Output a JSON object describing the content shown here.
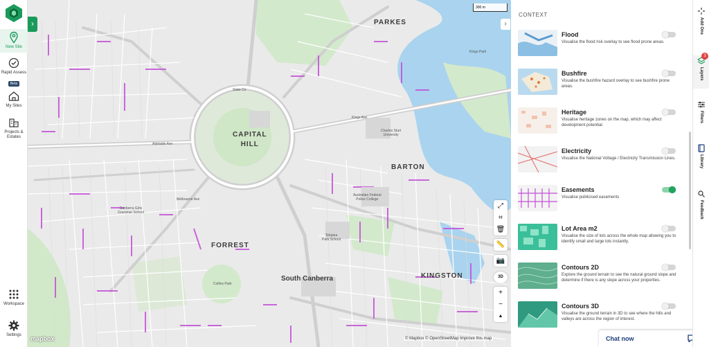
{
  "nav": {
    "items": [
      {
        "label": "New Site",
        "icon": "map-pin-icon"
      },
      {
        "label": "Rapid Assess",
        "badge": "Beta",
        "icon": "check-circle-icon"
      },
      {
        "label": "My Sites",
        "icon": "house-icon"
      },
      {
        "label": "Projects & Estates",
        "icon": "buildings-icon"
      },
      {
        "label": "Workspace",
        "icon": "grid-icon"
      },
      {
        "label": "Settings",
        "icon": "gear-icon"
      }
    ]
  },
  "map": {
    "scale_label": "300 m",
    "labels": {
      "capital_hill": "CAPITAL\nHILL",
      "parkes": "PARKES",
      "barton": "BARTON",
      "forrest": "FORREST",
      "south_canberra": "South Canberra",
      "kingston": "KINGSTON",
      "state_cir": "State Cir",
      "kings_ave": "Kings Ave",
      "adelaide_ave": "Adelaide Ave",
      "melbourne_ave": "Melbourne Ave",
      "canberra_girls": "Canberra Girls\nGrammar School",
      "telopea": "Telopea\nPark School",
      "charles_sturt": "Charles Sturt\nUniversity",
      "afp_college": "Australian Federal\nPolice College",
      "kings_park": "Kings Park",
      "collins_park": "Collins Park"
    },
    "attribution": "© Mapbox © OpenStreetMap Improve this map",
    "mapbox_logo": "mapbox"
  },
  "panel": {
    "title": "CONTEXT",
    "layers": [
      {
        "name": "Flood",
        "desc": "Visualise the flood risk overlay to see flood prone areas.",
        "enabled": false
      },
      {
        "name": "Bushfire",
        "desc": "Visualise the bushfire hazard overlay to see bushfire prone areas.",
        "enabled": false
      },
      {
        "name": "Heritage",
        "desc": "Visualise heritage zones on the map, which may affect development potential.",
        "enabled": false
      },
      {
        "name": "Electricity",
        "desc": "Visualise the National Voltage / Electricity Transmission Lines.",
        "enabled": false
      },
      {
        "name": "Easements",
        "desc": "Visualise publicised easements",
        "enabled": true
      },
      {
        "name": "Lot Area m2",
        "desc": "Visualise the size of lots across the whole map allowing you to identify small and large lots instantly.",
        "enabled": false
      },
      {
        "name": "Contours 2D",
        "desc": "Explore the ground terrain to see the natural ground slope and determine if there is any slope across your properties.",
        "enabled": false
      },
      {
        "name": "Contours 3D",
        "desc": "Visualise the ground terrain in 3D to see where the hills and valleys are across the region of interest.",
        "enabled": false
      }
    ]
  },
  "rail": {
    "items": [
      {
        "label": "Add Ons",
        "icon": "plus-dashed-icon"
      },
      {
        "label": "Layers",
        "icon": "layers-icon",
        "badge": "3"
      },
      {
        "label": "Filters",
        "icon": "sliders-icon"
      },
      {
        "label": "Library",
        "icon": "book-icon"
      },
      {
        "label": "Feedback",
        "icon": "search-chat-icon"
      }
    ]
  },
  "chat": {
    "label": "Chat now"
  },
  "colors": {
    "brand": "#1b9a5b",
    "easement": "#c24fd6",
    "water": "#a8d4ee",
    "park": "#cde8c6"
  }
}
